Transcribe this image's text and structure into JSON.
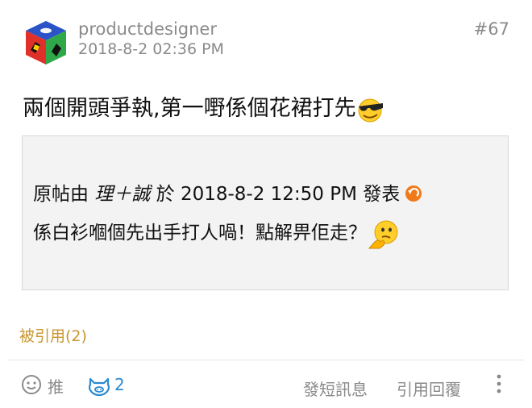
{
  "post": {
    "username": "productdesigner",
    "timestamp": "2018-8-2 02:36 PM",
    "number": "#67",
    "body": "兩個開頭爭執,第一嘢係個花裙打先",
    "body_emoji": "cool-sunglasses-smiley",
    "quote": {
      "prefix": "原帖由",
      "user": "理＋誠",
      "mid": "於",
      "time": "2018-8-2 12:50 PM",
      "suffix": "發表",
      "text": "係白衫嗰個先出手打人喎！點解畀佢走？",
      "text_emoji": "thinking-smiley"
    },
    "quoted_count": "被引用(2)"
  },
  "footer": {
    "like_label": "推",
    "pig_count": "2",
    "pm_label": "發短訊息",
    "reply_label": "引用回覆"
  },
  "colors": {
    "meta_gray": "#8a8a8a",
    "accent_gold": "#c9962f",
    "pig_blue": "#2a8ad1",
    "back_orange": "#f07a1a"
  }
}
